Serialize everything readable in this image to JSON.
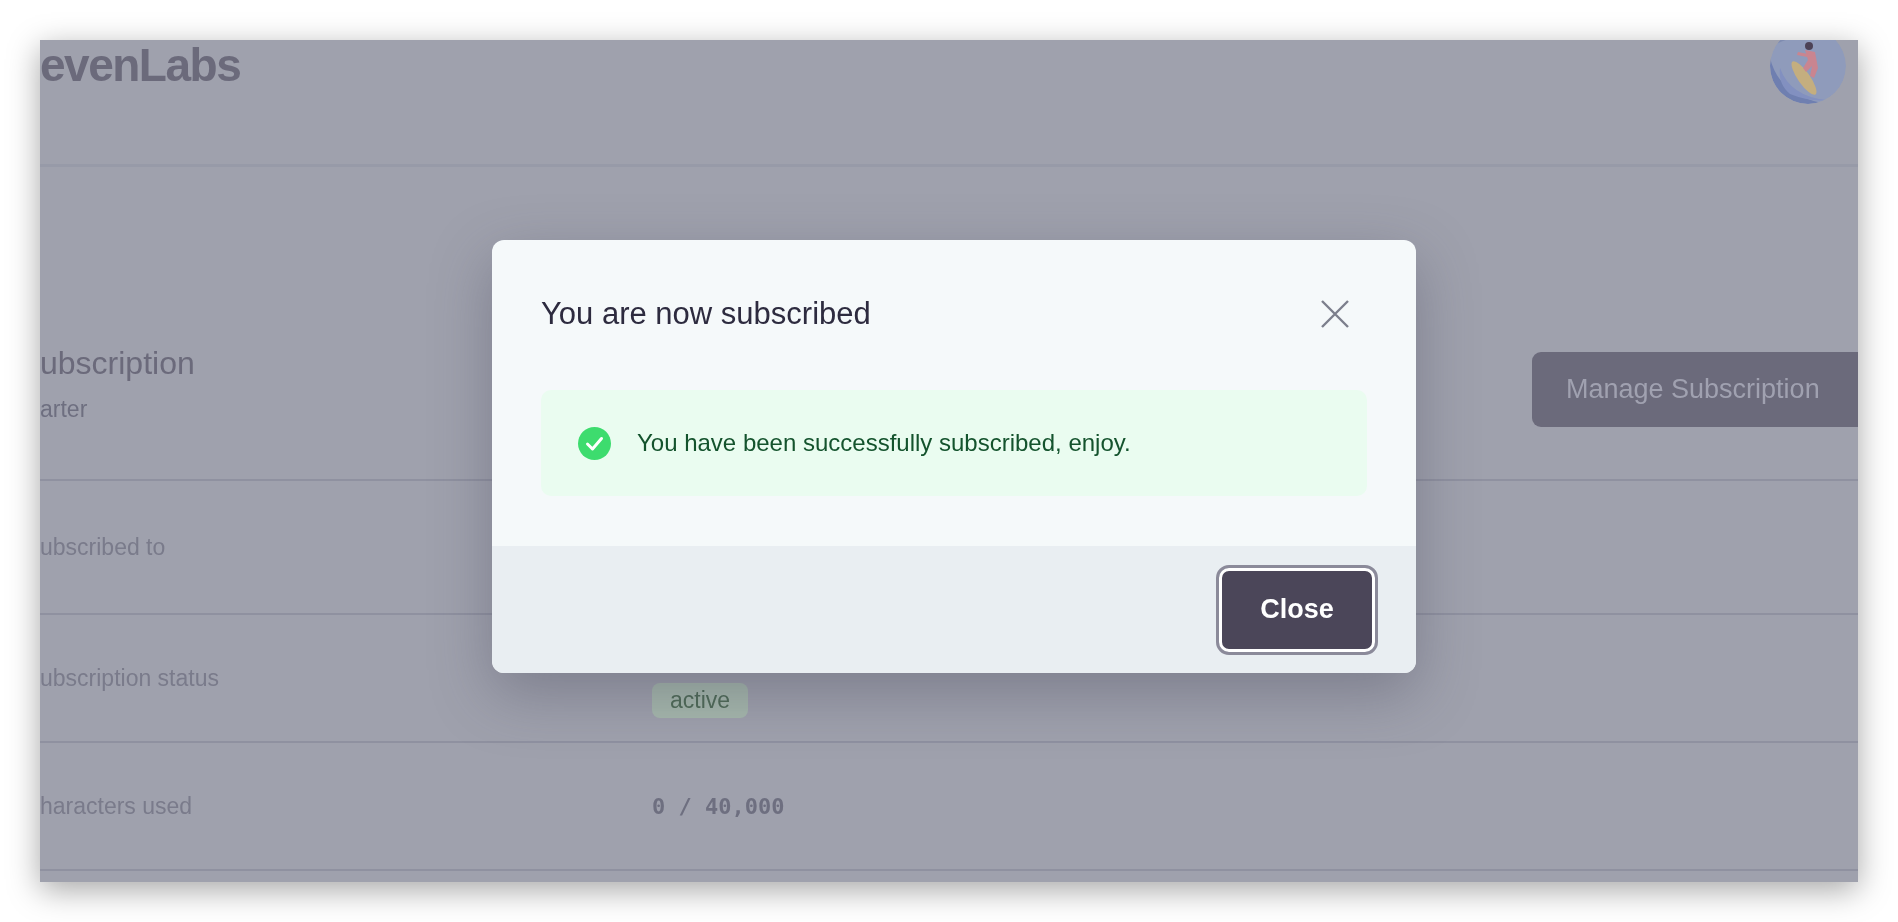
{
  "header": {
    "logo": "evenLabs"
  },
  "subscription": {
    "title": "ubscription",
    "plan": "arter",
    "manage_button": "Manage Subscription"
  },
  "rows": [
    {
      "label": "ubscribed to"
    },
    {
      "label": "ubscription status",
      "badge": "active"
    },
    {
      "label": "haracters used",
      "value": "0 / 40,000"
    }
  ],
  "dialog": {
    "title": "You are now subscribed",
    "alert": {
      "kind": "success",
      "message": "You have been successfully subscribed, enjoy."
    },
    "close_button": "Close"
  }
}
